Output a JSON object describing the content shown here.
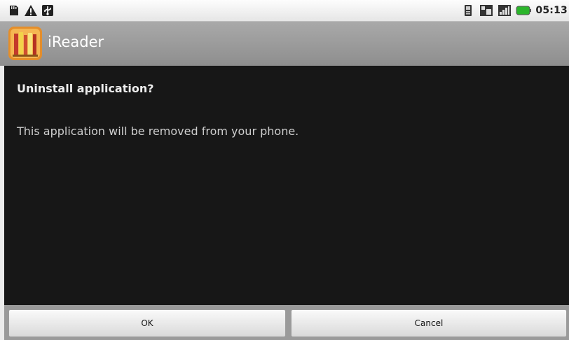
{
  "status_bar": {
    "time": "05:13",
    "left_icons": [
      "sd-card-icon",
      "warning-icon",
      "usb-icon"
    ],
    "right_icons": [
      "phone-icon",
      "network-icon",
      "signal-icon",
      "battery-icon"
    ]
  },
  "app": {
    "title": "iReader",
    "icon": "ireader-book-icon"
  },
  "dialog": {
    "heading": "Uninstall application?",
    "message": "This application will be removed from your phone."
  },
  "buttons": {
    "ok": "OK",
    "cancel": "Cancel"
  },
  "colors": {
    "content_bg": "#171717",
    "title_bar": "#9b9b9b",
    "battery": "#2bb52b"
  }
}
